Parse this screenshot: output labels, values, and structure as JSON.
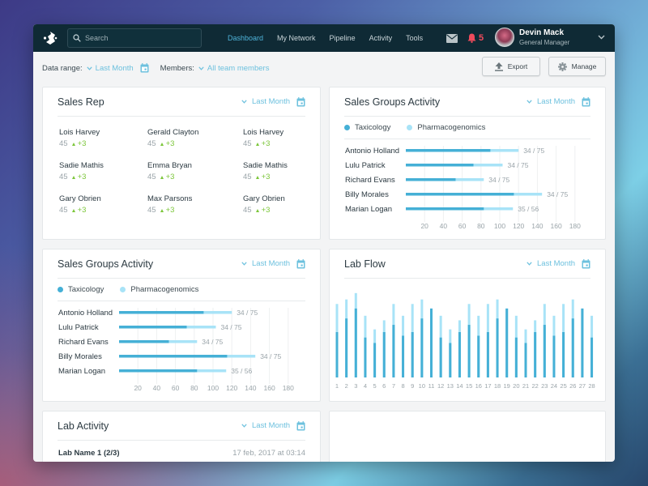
{
  "topbar": {
    "search_placeholder": "Search",
    "nav": [
      {
        "label": "Dashboard",
        "active": true
      },
      {
        "label": "My Network",
        "active": false
      },
      {
        "label": "Pipeline",
        "active": false
      },
      {
        "label": "Activity",
        "active": false
      },
      {
        "label": "Tools",
        "active": false
      }
    ],
    "notifications_count": "5",
    "user": {
      "name": "Devin Mack",
      "role": "General Manager"
    }
  },
  "filters": {
    "data_range_label": "Data range:",
    "data_range_value": "Last Month",
    "members_label": "Members:",
    "members_value": "All team members",
    "export_label": "Export",
    "manage_label": "Manage"
  },
  "colors": {
    "accent": "#4fb3d9",
    "taxicology": "#45b0d6",
    "pharmacogenomics": "#a8e3f7",
    "delta_positive": "#7cc63a",
    "alert": "#ef4b5c",
    "topbar": "#0f2a35"
  },
  "sales_rep": {
    "title": "Sales Rep",
    "range": "Last Month",
    "reps": [
      {
        "name": "Lois Harvey",
        "value": "45",
        "delta": "+3"
      },
      {
        "name": "Gerald Clayton",
        "value": "45",
        "delta": "+3"
      },
      {
        "name": "Lois Harvey",
        "value": "45",
        "delta": "+3"
      },
      {
        "name": "Sadie Mathis",
        "value": "45",
        "delta": "+3"
      },
      {
        "name": "Emma Bryan",
        "value": "45",
        "delta": "+3"
      },
      {
        "name": "Sadie Mathis",
        "value": "45",
        "delta": "+3"
      },
      {
        "name": "Gary Obrien",
        "value": "45",
        "delta": "+3"
      },
      {
        "name": "Max Parsons",
        "value": "45",
        "delta": "+3"
      },
      {
        "name": "Gary Obrien",
        "value": "45",
        "delta": "+3"
      }
    ]
  },
  "sales_groups_1": {
    "title": "Sales Groups Activity",
    "range": "Last Month",
    "legend": [
      "Taxicology",
      "Pharmacogenomics"
    ]
  },
  "sales_groups_2": {
    "title": "Sales Groups Activity",
    "range": "Last Month",
    "legend": [
      "Taxicology",
      "Pharmacogenomics"
    ]
  },
  "lab_flow": {
    "title": "Lab Flow",
    "range": "Last Month"
  },
  "lab_activity": {
    "title": "Lab Activity",
    "range": "Last Month",
    "rows": [
      {
        "name": "Lab Name 1 (2/3)",
        "time": "17 feb, 2017 at 03:14"
      }
    ]
  },
  "chart_data": [
    {
      "type": "bar",
      "orientation": "horizontal",
      "title": "Sales Groups Activity",
      "categories": [
        "Antonio Holland",
        "Lulu Patrick",
        "Richard Evans",
        "Billy Morales",
        "Marian Logan"
      ],
      "series": [
        {
          "name": "Taxicology",
          "values": [
            90,
            72,
            53,
            115,
            83
          ]
        },
        {
          "name": "Pharmacogenomics",
          "values": [
            120,
            103,
            83,
            145,
            114
          ]
        }
      ],
      "data_labels": [
        "34 / 75",
        "34 / 75",
        "34 / 75",
        "34 / 75",
        "35 / 56"
      ],
      "xticks": [
        20,
        40,
        60,
        80,
        100,
        120,
        140,
        160,
        180
      ],
      "xlim": [
        0,
        180
      ],
      "grid": true,
      "legend": "top-left"
    },
    {
      "type": "bar",
      "orientation": "horizontal",
      "title": "Sales Groups Activity",
      "categories": [
        "Antonio Holland",
        "Lulu Patrick",
        "Richard Evans",
        "Billy Morales",
        "Marian Logan"
      ],
      "series": [
        {
          "name": "Taxicology",
          "values": [
            90,
            72,
            53,
            115,
            83
          ]
        },
        {
          "name": "Pharmacogenomics",
          "values": [
            120,
            103,
            83,
            145,
            114
          ]
        }
      ],
      "data_labels": [
        "34 / 75",
        "34 / 75",
        "34 / 75",
        "34 / 75",
        "35 / 56"
      ],
      "xticks": [
        20,
        40,
        60,
        80,
        100,
        120,
        140,
        160,
        180
      ],
      "xlim": [
        0,
        180
      ],
      "grid": true,
      "legend": "top-left"
    },
    {
      "type": "bar",
      "orientation": "vertical",
      "stacked": true,
      "title": "Lab Flow",
      "categories": [
        "1",
        "2",
        "3",
        "4",
        "5",
        "6",
        "7",
        "8",
        "9",
        "10",
        "11",
        "12",
        "13",
        "14",
        "15",
        "16",
        "17",
        "18",
        "19",
        "20",
        "21",
        "22",
        "23",
        "24",
        "25",
        "26",
        "27",
        "28"
      ],
      "series": [
        {
          "name": "Taxicology",
          "values": [
            50,
            65,
            76,
            44,
            38,
            50,
            58,
            46,
            50,
            65,
            76,
            44,
            38,
            50,
            58,
            46,
            50,
            65,
            76,
            44,
            38,
            50,
            58,
            46,
            50,
            65,
            76,
            44
          ]
        },
        {
          "name": "Pharmacogenomics",
          "values": [
            81,
            86,
            93,
            68,
            53,
            63,
            81,
            68,
            81,
            86,
            76,
            68,
            53,
            63,
            81,
            68,
            81,
            86,
            76,
            68,
            53,
            63,
            81,
            68,
            81,
            86,
            76,
            68
          ]
        }
      ],
      "ylim": [
        0,
        100
      ],
      "grid": false,
      "legend": "none"
    }
  ]
}
